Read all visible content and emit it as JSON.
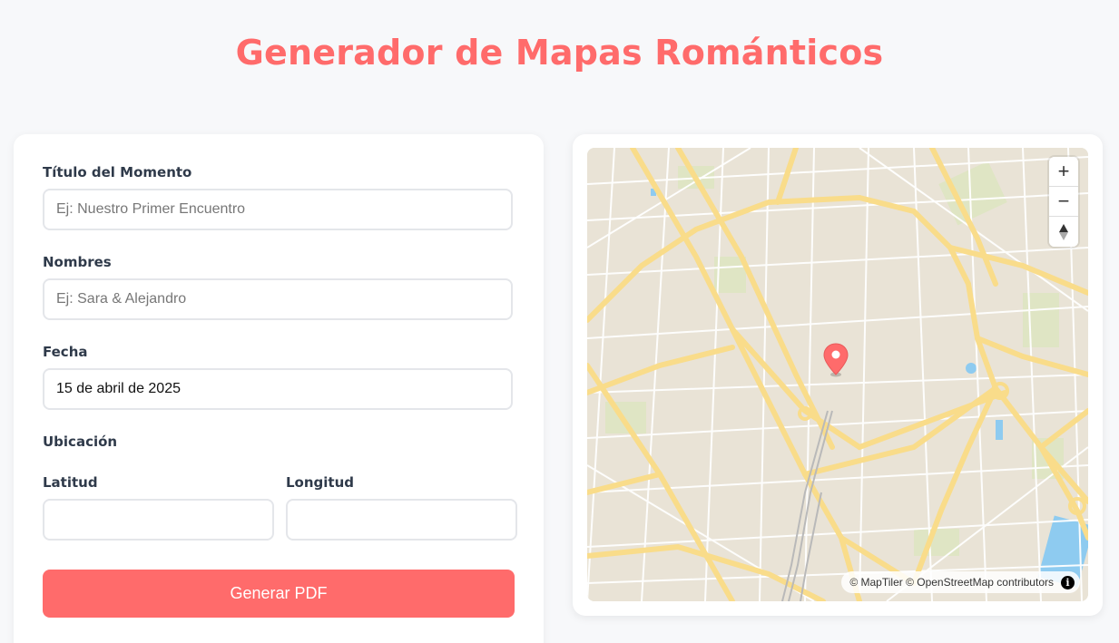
{
  "app": {
    "title": "Generador de Mapas Románticos"
  },
  "form": {
    "title_label": "Título del Momento",
    "title_placeholder": "Ej: Nuestro Primer Encuentro",
    "title_value": "",
    "names_label": "Nombres",
    "names_placeholder": "Ej: Sara & Alejandro",
    "names_value": "",
    "date_label": "Fecha",
    "date_value": "15 de abril de 2025",
    "location_label": "Ubicación",
    "lat_label": "Latitud",
    "lat_value": "",
    "lng_label": "Longitud",
    "lng_value": "",
    "submit_label": "Generar PDF"
  },
  "map": {
    "zoom_in_label": "+",
    "zoom_out_label": "−",
    "attribution": "© MapTiler © OpenStreetMap contributors",
    "info_label": "i"
  },
  "colors": {
    "accent": "#ff6b6b",
    "label_text": "#2f3a4a",
    "input_border": "#e4e6ea",
    "map_land": "#e9e3d6",
    "map_major_road": "#f9dc8a",
    "map_minor_road": "#ffffff",
    "map_park": "#dfe5c4",
    "map_water": "#8ecbf0"
  },
  "icons": {
    "marker": "map-pin-icon",
    "compass": "compass-icon",
    "info": "info-icon"
  }
}
